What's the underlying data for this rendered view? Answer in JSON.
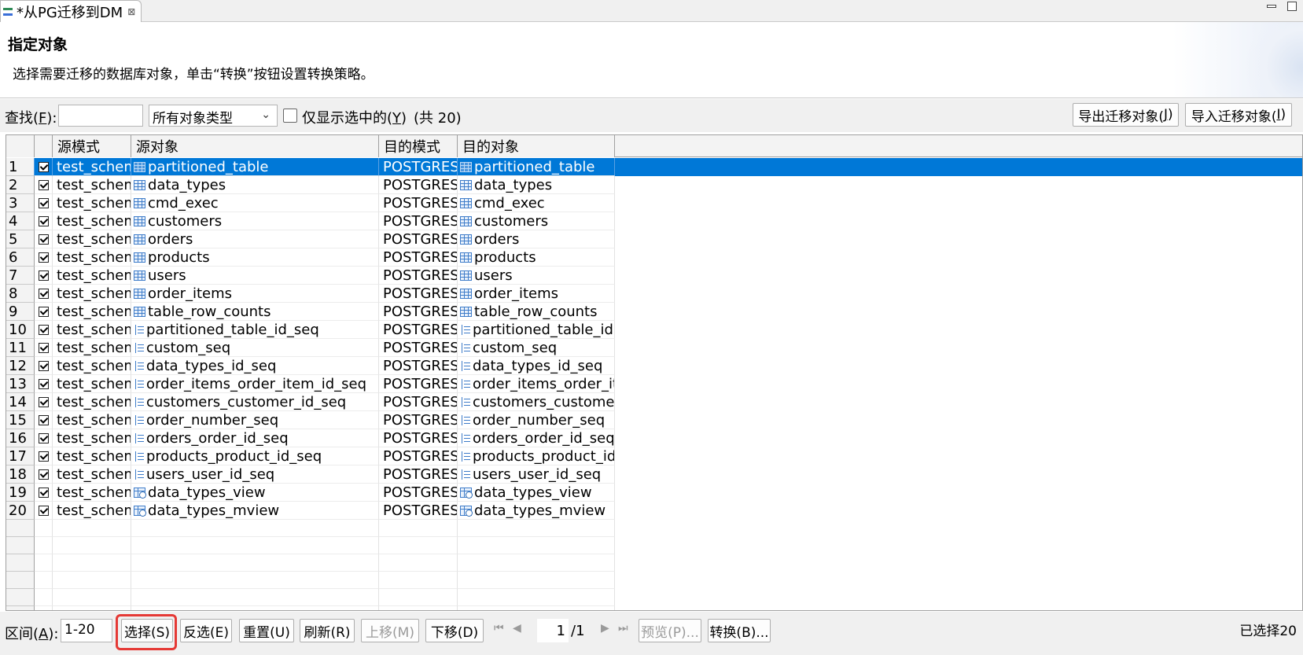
{
  "tab": {
    "title": "*从PG迁移到DM",
    "close": "⊠"
  },
  "header": {
    "title": "指定对象",
    "description": "选择需要迁移的数据库对象，单击“转换”按钮设置转换策略。"
  },
  "toolbar": {
    "find_label": "查找(",
    "find_key": "F",
    "find_suffix": "):",
    "search_value": "",
    "type_select": "所有对象类型",
    "only_selected_label": "仅显示选中的(",
    "only_selected_key": "Y",
    "only_selected_suffix": ")",
    "count_text": "(共 20)",
    "export_label": "导出迁移对象(",
    "export_key": "J",
    "export_suffix": ")",
    "import_label": "导入迁移对象(",
    "import_key": "I",
    "import_suffix": ")"
  },
  "table": {
    "columns": [
      "源模式",
      "源对象",
      "目的模式",
      "目的对象"
    ],
    "rows": [
      {
        "num": "1",
        "src_schema": "test_schem",
        "src_obj": "partitioned_table",
        "dst_schema": "POSTGRES",
        "dst_obj": "partitioned_table",
        "icon": "table-icon",
        "selected": true
      },
      {
        "num": "2",
        "src_schema": "test_schem",
        "src_obj": "data_types",
        "dst_schema": "POSTGRES",
        "dst_obj": "data_types",
        "icon": "table-icon"
      },
      {
        "num": "3",
        "src_schema": "test_schem",
        "src_obj": "cmd_exec",
        "dst_schema": "POSTGRES",
        "dst_obj": "cmd_exec",
        "icon": "table-icon"
      },
      {
        "num": "4",
        "src_schema": "test_schem",
        "src_obj": "customers",
        "dst_schema": "POSTGRES",
        "dst_obj": "customers",
        "icon": "table-icon"
      },
      {
        "num": "5",
        "src_schema": "test_schem",
        "src_obj": "orders",
        "dst_schema": "POSTGRES",
        "dst_obj": "orders",
        "icon": "table-icon"
      },
      {
        "num": "6",
        "src_schema": "test_schem",
        "src_obj": "products",
        "dst_schema": "POSTGRES",
        "dst_obj": "products",
        "icon": "table-icon"
      },
      {
        "num": "7",
        "src_schema": "test_schem",
        "src_obj": "users",
        "dst_schema": "POSTGRES",
        "dst_obj": "users",
        "icon": "table-icon"
      },
      {
        "num": "8",
        "src_schema": "test_schem",
        "src_obj": "order_items",
        "dst_schema": "POSTGRES",
        "dst_obj": "order_items",
        "icon": "table-icon"
      },
      {
        "num": "9",
        "src_schema": "test_schem",
        "src_obj": "table_row_counts",
        "dst_schema": "POSTGRES",
        "dst_obj": "table_row_counts",
        "icon": "table-icon"
      },
      {
        "num": "10",
        "src_schema": "test_schem",
        "src_obj": "partitioned_table_id_seq",
        "dst_schema": "POSTGRES",
        "dst_obj": "partitioned_table_id.",
        "icon": "sequence-icon"
      },
      {
        "num": "11",
        "src_schema": "test_schem",
        "src_obj": "custom_seq",
        "dst_schema": "POSTGRES",
        "dst_obj": "custom_seq",
        "icon": "sequence-icon"
      },
      {
        "num": "12",
        "src_schema": "test_schem",
        "src_obj": "data_types_id_seq",
        "dst_schema": "POSTGRES",
        "dst_obj": "data_types_id_seq",
        "icon": "sequence-icon"
      },
      {
        "num": "13",
        "src_schema": "test_schem",
        "src_obj": "order_items_order_item_id_seq",
        "dst_schema": "POSTGRES",
        "dst_obj": "order_items_order_it",
        "icon": "sequence-icon"
      },
      {
        "num": "14",
        "src_schema": "test_schem",
        "src_obj": "customers_customer_id_seq",
        "dst_schema": "POSTGRES",
        "dst_obj": "customers_customer",
        "icon": "sequence-icon"
      },
      {
        "num": "15",
        "src_schema": "test_schem",
        "src_obj": "order_number_seq",
        "dst_schema": "POSTGRES",
        "dst_obj": "order_number_seq",
        "icon": "sequence-icon"
      },
      {
        "num": "16",
        "src_schema": "test_schem",
        "src_obj": "orders_order_id_seq",
        "dst_schema": "POSTGRES",
        "dst_obj": "orders_order_id_seq",
        "icon": "sequence-icon"
      },
      {
        "num": "17",
        "src_schema": "test_schem",
        "src_obj": "products_product_id_seq",
        "dst_schema": "POSTGRES",
        "dst_obj": "products_product_id",
        "icon": "sequence-icon"
      },
      {
        "num": "18",
        "src_schema": "test_schem",
        "src_obj": "users_user_id_seq",
        "dst_schema": "POSTGRES",
        "dst_obj": "users_user_id_seq",
        "icon": "sequence-icon"
      },
      {
        "num": "19",
        "src_schema": "test_schem",
        "src_obj": "data_types_view",
        "dst_schema": "POSTGRES",
        "dst_obj": "data_types_view",
        "icon": "view-icon"
      },
      {
        "num": "20",
        "src_schema": "test_schem",
        "src_obj": "data_types_mview",
        "dst_schema": "POSTGRES",
        "dst_obj": "data_types_mview",
        "icon": "view-icon"
      }
    ]
  },
  "bottom": {
    "range_label": "区间(",
    "range_key": "A",
    "range_suffix": "):",
    "range_value": "1-20",
    "select_label": "选择(S)",
    "invert_label": "反选(E)",
    "reset_label": "重置(U)",
    "refresh_label": "刷新(R)",
    "move_up_label": "上移(M)",
    "move_down_label": "下移(D)",
    "page_value": "1",
    "page_total": "/1",
    "preview_label": "预览(P)...",
    "convert_label": "转换(B)...",
    "status": "已选择20"
  },
  "colors": {
    "selection": "#0078d7",
    "highlight": "#e53935"
  }
}
